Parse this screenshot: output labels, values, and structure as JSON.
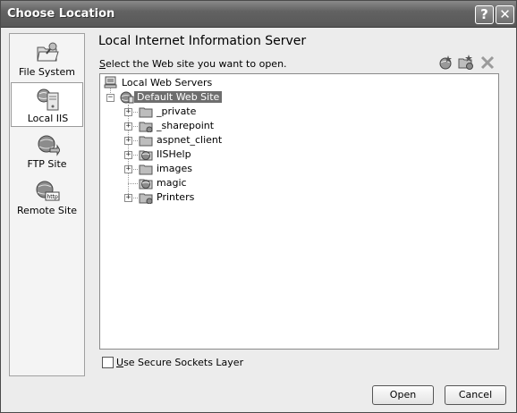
{
  "window": {
    "title": "Choose Location",
    "help_glyph": "?",
    "close_glyph": "✕"
  },
  "sidebar": {
    "items": [
      {
        "label": "File System",
        "icon": "folder-icon",
        "selected": false
      },
      {
        "label": "Local IIS",
        "icon": "server-icon",
        "selected": true
      },
      {
        "label": "FTP Site",
        "icon": "ftp-globe-icon",
        "selected": false
      },
      {
        "label": "Remote Site",
        "icon": "http-globe-icon",
        "selected": false
      }
    ]
  },
  "main": {
    "heading": "Local Internet Information Server",
    "instruction_first": "S",
    "instruction_rest": "elect the Web site you want to open.",
    "toolbar_icons": [
      "create-web-application-icon",
      "create-virtual-directory-icon",
      "delete-icon"
    ]
  },
  "tree": {
    "root": {
      "label": "Local Web Servers",
      "icon": "computer-icon"
    },
    "site": {
      "label": "Default Web Site",
      "icon": "web-site-icon",
      "expander": "−",
      "selected": true
    },
    "children": [
      {
        "label": "_private",
        "icon": "folder-icon",
        "expander": "+"
      },
      {
        "label": "_sharepoint",
        "icon": "virtual-folder-icon",
        "expander": "+"
      },
      {
        "label": "aspnet_client",
        "icon": "folder-icon",
        "expander": "+"
      },
      {
        "label": "IISHelp",
        "icon": "web-app-icon",
        "expander": "+"
      },
      {
        "label": "images",
        "icon": "folder-icon",
        "expander": "+"
      },
      {
        "label": "magic",
        "icon": "web-app-icon",
        "expander": ""
      },
      {
        "label": "Printers",
        "icon": "virtual-folder-icon",
        "expander": "+"
      }
    ]
  },
  "options": {
    "ssl_first": "U",
    "ssl_rest": "se Secure Sockets Layer",
    "ssl_checked": false
  },
  "buttons": {
    "open": "Open",
    "cancel": "Cancel"
  }
}
